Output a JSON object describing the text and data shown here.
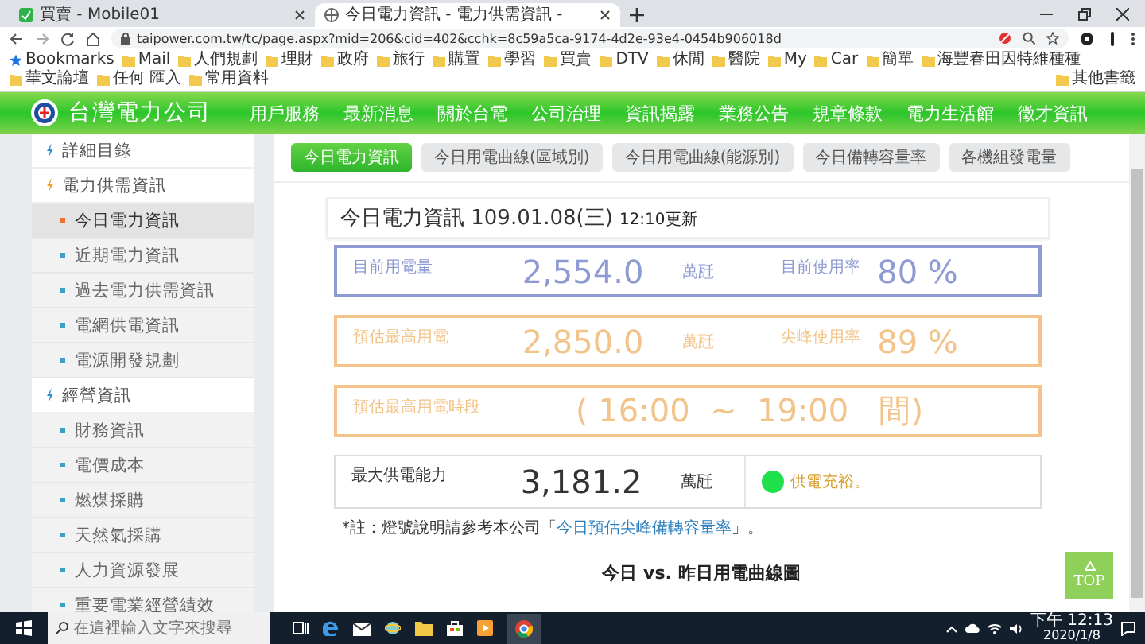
{
  "browser": {
    "tabs": [
      {
        "title": "買賣 - Mobile01",
        "selected": false
      },
      {
        "title": "今日電力資訊 - 電力供需資訊 -",
        "selected": true
      }
    ],
    "url": "taipower.com.tw/tc/page.aspx?mid=206&cid=402&cchk=8c59a5ca-9174-4d2e-93e4-0454b906018d",
    "bookmarks_label": "Bookmarks",
    "bookmarks": [
      "Mail",
      "人們規劃",
      "理財",
      "政府",
      "旅行",
      "購置",
      "學習",
      "買賣",
      "DTV",
      "休閒",
      "醫院",
      "My",
      "Car",
      "簡單",
      "海豐春田因特維種種",
      "華文論壇",
      "任何 匯入",
      "常用資料"
    ],
    "other_bookmarks": "其他書籤"
  },
  "site": {
    "logo_text": "台灣電力公司",
    "nav": [
      "用戶服務",
      "最新消息",
      "關於台電",
      "公司治理",
      "資訊揭露",
      "業務公告",
      "規章條款",
      "電力生活館",
      "徵才資訊"
    ]
  },
  "sidebar": {
    "groups": [
      {
        "label": "詳細目錄"
      },
      {
        "label": "電力供需資訊",
        "children": [
          {
            "label": "今日電力資訊",
            "selected": true
          },
          {
            "label": "近期電力資訊",
            "selected": false
          },
          {
            "label": "過去電力供需資訊",
            "selected": false
          },
          {
            "label": "電網供電資訊",
            "selected": false
          },
          {
            "label": "電源開發規劃",
            "selected": false
          }
        ]
      },
      {
        "label": "經營資訊",
        "children": [
          {
            "label": "財務資訊",
            "selected": false
          },
          {
            "label": "電價成本",
            "selected": false
          },
          {
            "label": "燃煤採購",
            "selected": false
          },
          {
            "label": "天然氣採購",
            "selected": false
          },
          {
            "label": "人力資源發展",
            "selected": false
          },
          {
            "label": "重要電業經營績效",
            "selected": false
          }
        ]
      }
    ]
  },
  "sub_tabs": [
    {
      "label": "今日電力資訊",
      "selected": true
    },
    {
      "label": "今日用電曲線(區域別)",
      "selected": false
    },
    {
      "label": "今日用電曲線(能源別)",
      "selected": false
    },
    {
      "label": "今日備轉容量率",
      "selected": false
    },
    {
      "label": "各機組發電量",
      "selected": false
    }
  ],
  "panel": {
    "title": "今日電力資訊 109.01.08(三)",
    "updated": "12:10更新",
    "rows": [
      {
        "kind": "pair",
        "color": "#8e9bd2",
        "label": "目前用電量",
        "value": "2,554.0",
        "unit": "萬瓩",
        "label2": "目前使用率",
        "value2": "80 %"
      },
      {
        "kind": "pair",
        "color": "#f2c48a",
        "label": "預估最高用電",
        "value": "2,850.0",
        "unit": "萬瓩",
        "label2": "尖峰使用率",
        "value2": "89 %"
      },
      {
        "kind": "period",
        "color": "#f2c48a",
        "label": "預估最高用電時段",
        "value": "( 16:00  ~  19:00   間)"
      },
      {
        "kind": "capacity",
        "color": "#dddddd",
        "label": "最大供電能力",
        "value": "3,181.2",
        "unit": "萬瓩",
        "status": {
          "label": "供電充裕。",
          "color": "#1ee04a"
        }
      }
    ],
    "note": {
      "before": "*註：燈號說明請參考本公司「",
      "link": "今日預估尖峰備轉容量率",
      "after": "」。"
    }
  },
  "chart_heading": "今日 vs. 昨日用電曲線圖",
  "top_button": {
    "label": "TOP"
  },
  "taskbar": {
    "search_placeholder": "在這裡輸入文字來搜尋",
    "time": "下午 12:13",
    "date": "2020/1/8"
  }
}
